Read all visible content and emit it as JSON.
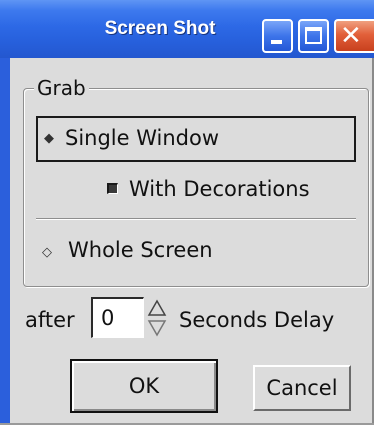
{
  "window": {
    "title": "Screen Shot",
    "controls": {
      "minimize": "minimize",
      "maximize": "maximize",
      "close": "close"
    }
  },
  "grab": {
    "legend": "Grab",
    "single_window_label": "Single Window",
    "with_decorations_label": "With Decorations",
    "with_decorations_checked": true,
    "whole_screen_label": "Whole Screen",
    "selected": "Single Window"
  },
  "delay": {
    "prefix": "after",
    "value": "0",
    "suffix": "Seconds Delay"
  },
  "buttons": {
    "ok": "OK",
    "cancel": "Cancel"
  },
  "icons": {
    "radio": "diamond-radio-icon",
    "spinner": "spinner-arrows-icon"
  },
  "colors": {
    "titlebar": "#2d69e6",
    "close_button": "#e2603a",
    "dialog_bg": "#dcdcdc"
  }
}
